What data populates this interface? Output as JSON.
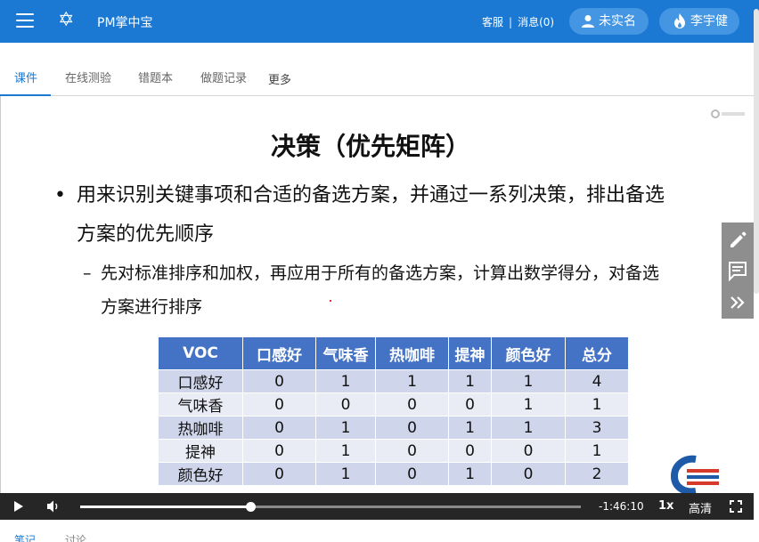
{
  "header": {
    "app_title": "PM掌中宝",
    "service_link": "客服",
    "separator": "|",
    "messages_link": "消息(0)",
    "user_status": "未实名",
    "user_name": "李宇健",
    "brand_color": "#1b79d4"
  },
  "tabs": [
    {
      "label": "课件",
      "active": true
    },
    {
      "label": "在线测验",
      "active": false
    },
    {
      "label": "错题本",
      "active": false
    },
    {
      "label": "做题记录",
      "active": false
    },
    {
      "label": "更多",
      "active": false
    }
  ],
  "slide": {
    "title": "决策（优先矩阵）",
    "bullet_symbol": "•",
    "bullet_text": "用来识别关键事项和合适的备选方案，并通过一系列决策，排出备选方案的优先顺序",
    "sub_symbol": "–",
    "sub_bullet_text": "先对标准排序和加权，再应用于所有的备选方案，计算出数学得分，对备选方案进行排序",
    "table": {
      "headers": [
        "VOC",
        "口感好",
        "气味香",
        "热咖啡",
        "提神",
        "颜色好",
        "总分"
      ],
      "rows": [
        [
          "口感好",
          "0",
          "1",
          "1",
          "1",
          "1",
          "4"
        ],
        [
          "气味香",
          "0",
          "0",
          "0",
          "0",
          "1",
          "1"
        ],
        [
          "热咖啡",
          "0",
          "1",
          "0",
          "1",
          "1",
          "3"
        ],
        [
          "提神",
          "0",
          "1",
          "0",
          "0",
          "0",
          "1"
        ],
        [
          "颜色好",
          "0",
          "1",
          "0",
          "1",
          "0",
          "2"
        ]
      ],
      "header_color": "#4472c4"
    }
  },
  "side_tools": [
    "pencil-icon",
    "comment-icon",
    "double-chevron-right-icon"
  ],
  "player": {
    "progress": 0.34,
    "time_remaining": "-1:46:10",
    "speed": "1x",
    "quality": "高清"
  },
  "bottom_tabs": [
    {
      "label": "笔记",
      "active": true
    },
    {
      "label": "讨论",
      "active": false
    }
  ]
}
